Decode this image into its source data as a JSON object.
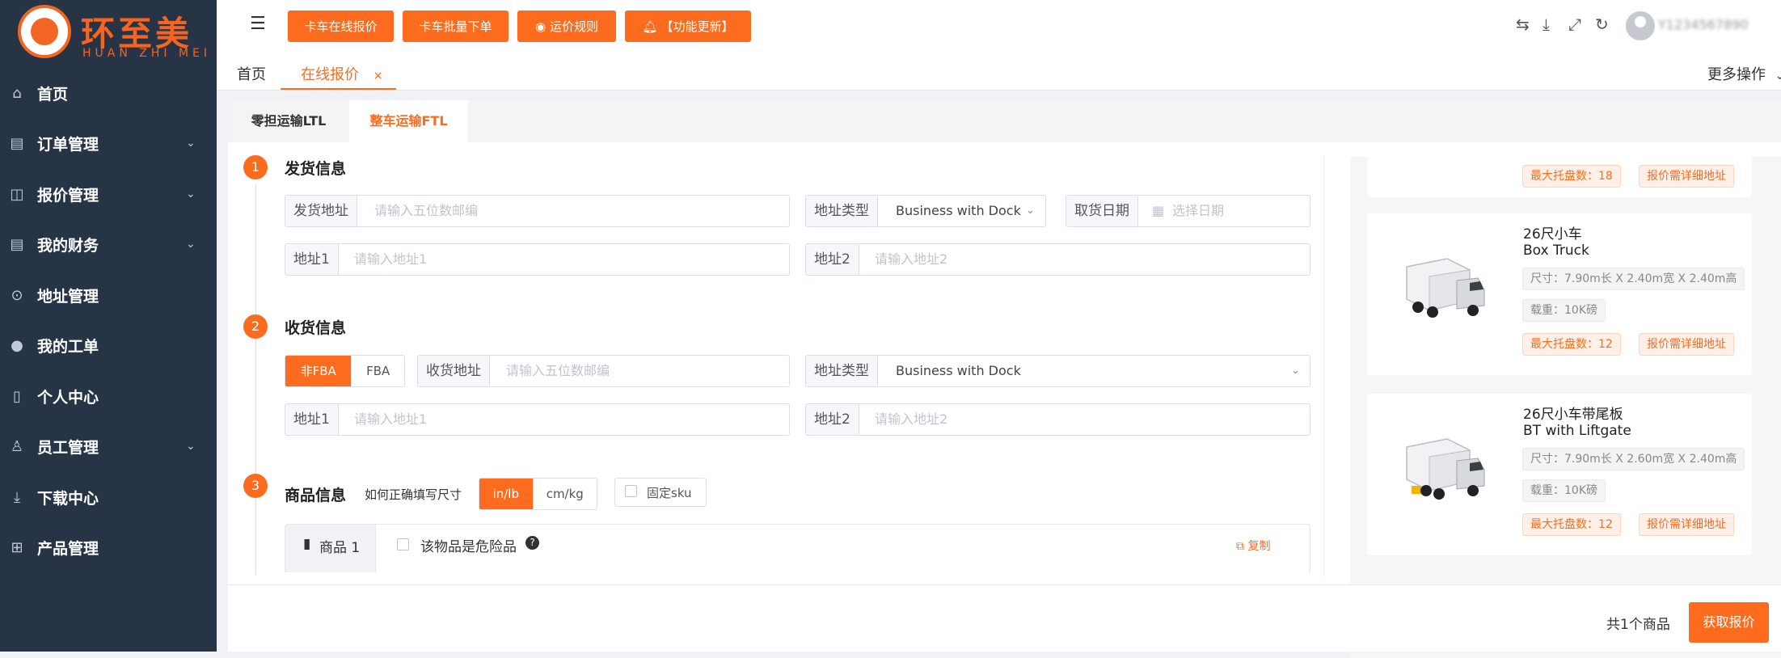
{
  "brand": {
    "name_cn": "环至美",
    "name_en": "HUAN ZHI MEI"
  },
  "sidebar": {
    "items": [
      {
        "label": "首页",
        "icon": "home-icon",
        "has_arrow": false
      },
      {
        "label": "订单管理",
        "icon": "order-icon",
        "has_arrow": true
      },
      {
        "label": "报价管理",
        "icon": "book-icon",
        "has_arrow": true
      },
      {
        "label": "我的财务",
        "icon": "finance-icon",
        "has_arrow": true
      },
      {
        "label": "地址管理",
        "icon": "location-icon",
        "has_arrow": false
      },
      {
        "label": "我的工单",
        "icon": "bulb-icon",
        "has_arrow": false
      },
      {
        "label": "个人中心",
        "icon": "phone-icon",
        "has_arrow": false
      },
      {
        "label": "员工管理",
        "icon": "user-icon",
        "has_arrow": true
      },
      {
        "label": "下载中心",
        "icon": "download-icon",
        "has_arrow": false
      },
      {
        "label": "产品管理",
        "icon": "product-icon",
        "has_arrow": false
      }
    ]
  },
  "topbar": {
    "buttons": [
      "卡车在线报价",
      "卡车批量下单",
      "运价规则",
      "【功能更新】"
    ],
    "user": "Y1234567890"
  },
  "page_tabs": {
    "home": "首页",
    "active": "在线报价",
    "close": "×",
    "more": "更多操作"
  },
  "mode_tabs": {
    "ltl": "零担运输LTL",
    "ftl": "整车运输FTL"
  },
  "sections": {
    "ship": {
      "num": "1",
      "title": "发货信息",
      "zip_label": "发货地址",
      "zip_placeholder": "请输入五位数邮编",
      "type_label": "地址类型",
      "type_value": "Business with Dock",
      "date_label": "取货日期",
      "date_placeholder": "选择日期",
      "addr1_label": "地址1",
      "addr1_placeholder": "请输入地址1",
      "addr2_label": "地址2",
      "addr2_placeholder": "请输入地址2"
    },
    "recv": {
      "num": "2",
      "title": "收货信息",
      "non_fba": "非FBA",
      "fba": "FBA",
      "zip_label": "收货地址",
      "zip_placeholder": "请输入五位数邮编",
      "type_label": "地址类型",
      "type_value": "Business with Dock",
      "addr1_label": "地址1",
      "addr1_placeholder": "请输入地址1",
      "addr2_label": "地址2",
      "addr2_placeholder": "请输入地址2"
    },
    "goods": {
      "num": "3",
      "title": "商品信息",
      "hint": "如何正确填写尺寸",
      "unit_in": "in/lb",
      "unit_cm": "cm/kg",
      "fixed_sku": "固定sku",
      "item_tab": "商品 1",
      "dangerous": "该物品是危险品",
      "copy": "复制"
    }
  },
  "trucks": [
    {
      "tags_top": [
        "最大托盘数：18",
        "报价需详细地址"
      ]
    },
    {
      "title_cn": "26尺小车",
      "title_en": "Box Truck",
      "size": "尺寸：7.90m长 X 2.40m宽 X 2.40m高",
      "load": "载重：10K磅",
      "pallets": "最大托盘数：12",
      "note": "报价需详细地址"
    },
    {
      "title_cn": "26尺小车带尾板",
      "title_en": "BT with Liftgate",
      "size": "尺寸：7.90m长 X 2.60m宽 X 2.40m高",
      "load": "载重：10K磅",
      "pallets": "最大托盘数：12",
      "note": "报价需详细地址"
    }
  ],
  "footer": {
    "count": "共1个商品",
    "quote_button": "获取报价"
  },
  "colors": {
    "accent": "#fd6b1e",
    "sidebar": "#263445"
  }
}
